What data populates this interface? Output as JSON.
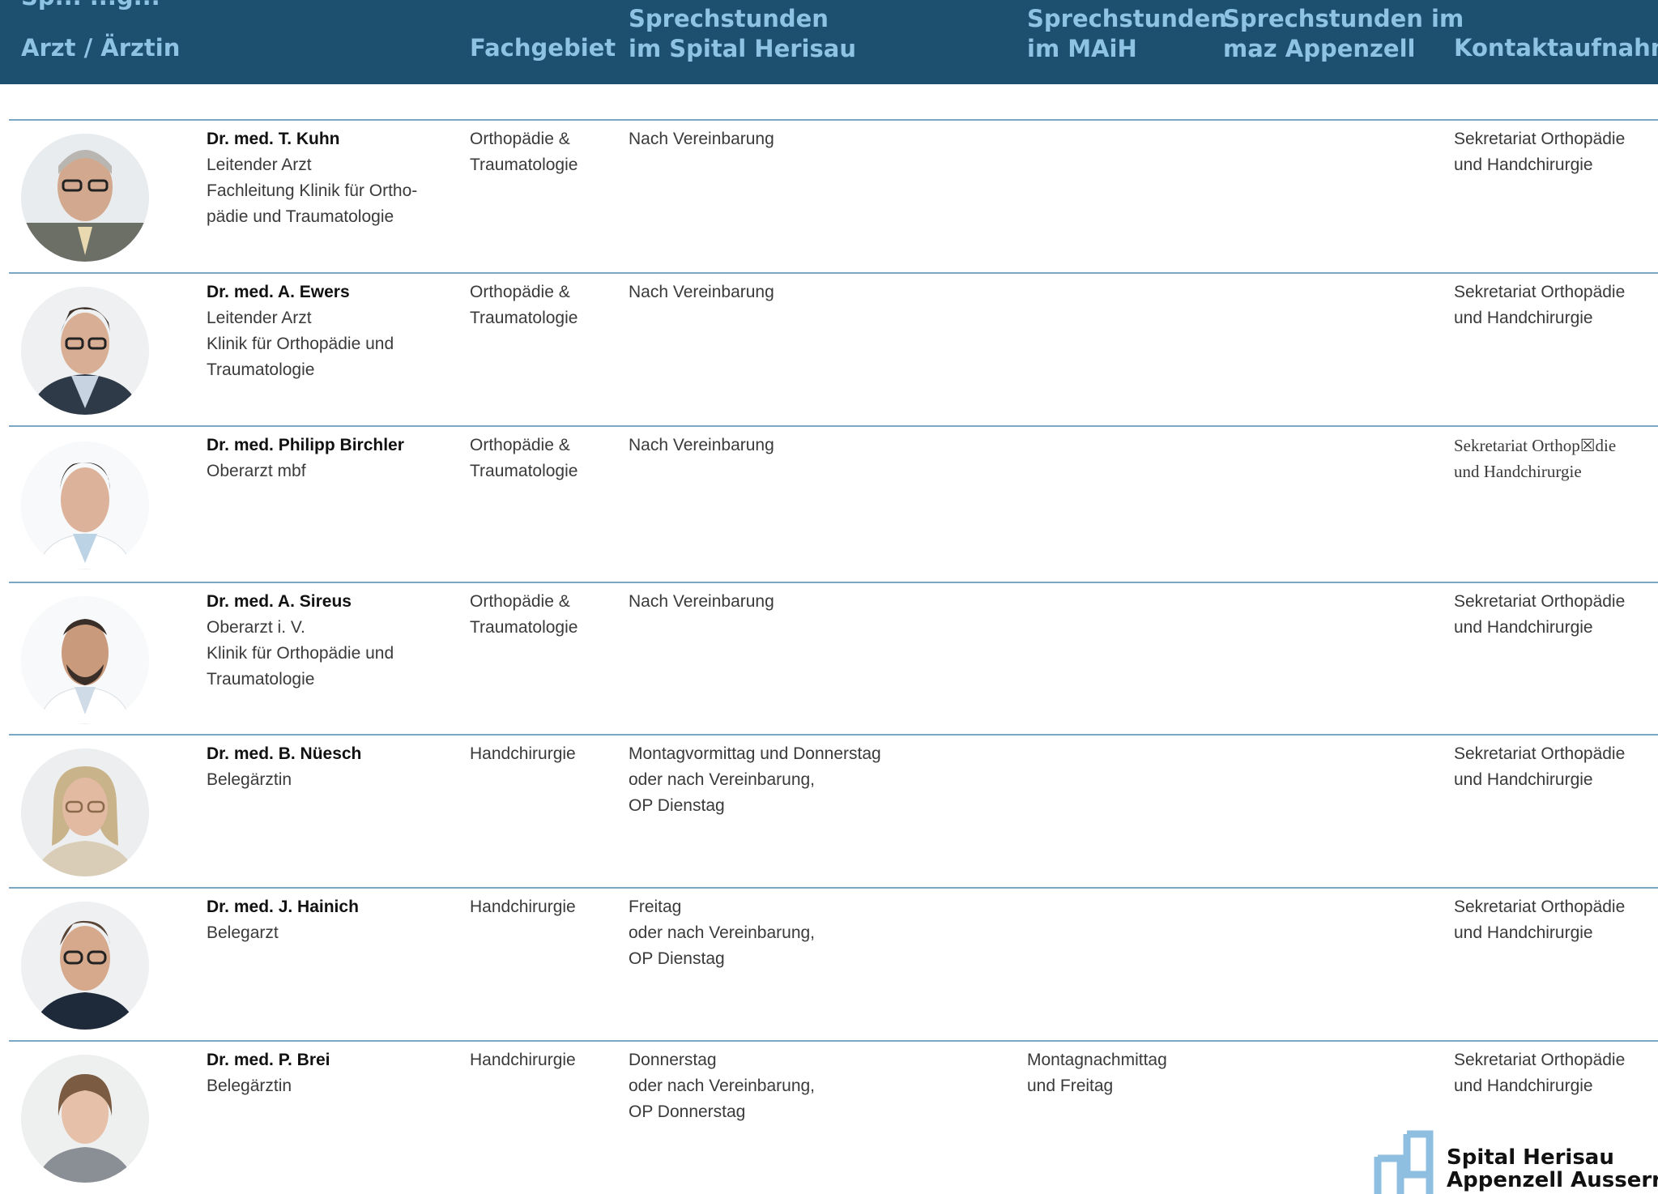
{
  "colors": {
    "header_bg": "#1d4f6f",
    "header_text": "#8ec3e3",
    "rule": "#7aa7c3"
  },
  "header": {
    "top_fragment": "Sp... ...g...",
    "col_arzt": "Arzt / Ärztin",
    "col_fach": "Fachgebiet",
    "col_herisau": "Sprechstunden\nim Spital Herisau",
    "col_maih": "Sprechstunden\nim MAiH",
    "col_maz": "Sprechstunden im\nmaz Appenzell",
    "col_kontakt": "Kontaktaufnahme"
  },
  "doctors": [
    {
      "name": "Dr. med. T. Kuhn",
      "role": "Leitender Arzt\nFachleitung Klinik für Ortho-\npädie und Traumatologie",
      "fach": "Orthopädie &\nTraumatologie",
      "herisau": "Nach Vereinbarung",
      "maih": "",
      "maz": "",
      "kontakt": "Sekretariat Orthopädie\nund Handchirurgie"
    },
    {
      "name": "Dr. med. A. Ewers",
      "role": "Leitender Arzt\nKlinik für Orthopädie und\nTraumatologie",
      "fach": "Orthopädie &\nTraumatologie",
      "herisau": "Nach Vereinbarung",
      "maih": "",
      "maz": "",
      "kontakt": "Sekretariat Orthopädie\nund Handchirurgie"
    },
    {
      "name": "Dr. med. Philipp Birchler",
      "role": "Oberarzt mbf",
      "fach": "Orthopädie &\nTraumatologie",
      "herisau": "Nach Vereinbarung",
      "maih": "",
      "maz": "",
      "kontakt": "Sekretariat Orthop☒die\nund Handchirurgie"
    },
    {
      "name": "Dr. med. A. Sireus",
      "role": "Oberarzt i. V.\nKlinik für Orthopädie und\nTraumatologie",
      "fach": "Orthopädie &\nTraumatologie",
      "herisau": "Nach Vereinbarung",
      "maih": "",
      "maz": "",
      "kontakt": "Sekretariat Orthopädie\nund Handchirurgie"
    },
    {
      "name": "Dr. med. B. Nüesch",
      "role": "Belegärztin",
      "fach": "Handchirurgie",
      "herisau": "Montagvormittag und Donnerstag\noder nach Vereinbarung,\nOP Dienstag",
      "maih": "",
      "maz": "",
      "kontakt": "Sekretariat Orthopädie\nund Handchirurgie"
    },
    {
      "name": "Dr. med. J. Hainich",
      "role": "Belegarzt",
      "fach": "Handchirurgie",
      "herisau": "Freitag\noder nach Vereinbarung,\nOP Dienstag",
      "maih": "",
      "maz": "",
      "kontakt": "Sekretariat Orthopädie\nund Handchirurgie"
    },
    {
      "name": "Dr. med. P. Brei",
      "role": "Belegärztin",
      "fach": "Handchirurgie",
      "herisau": "Donnerstag\noder nach Vereinbarung,\nOP Donnerstag",
      "maih": "Montagnachmittag\nund Freitag",
      "maz": "",
      "kontakt": "Sekretariat Orthopädie\nund Handchirurgie"
    }
  ],
  "logo": {
    "line1": "Spital Herisau",
    "line2": "Appenzell Ausserrhoden"
  }
}
